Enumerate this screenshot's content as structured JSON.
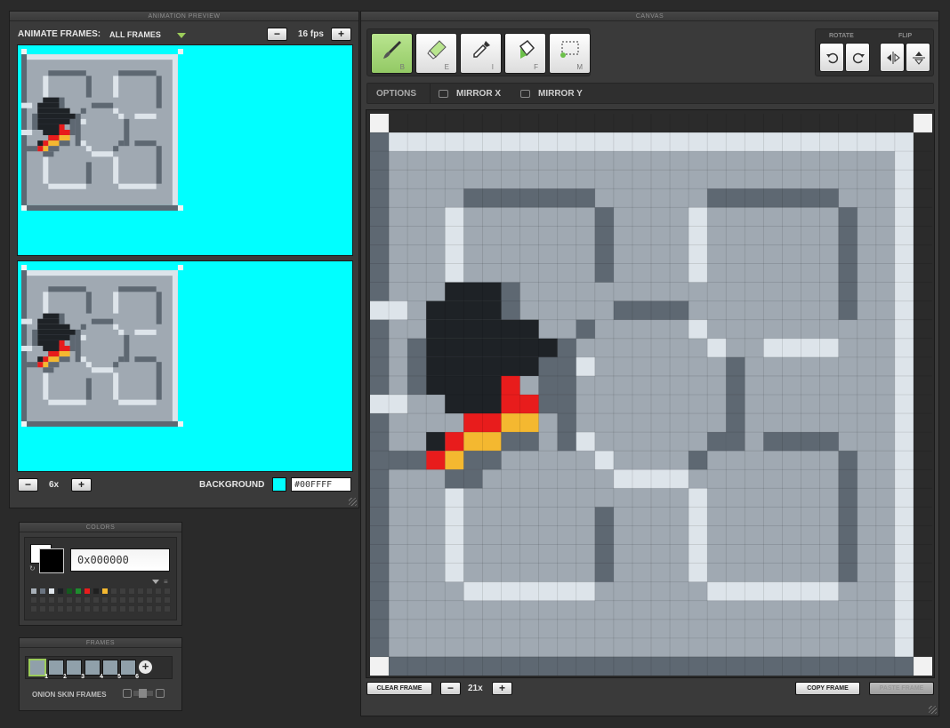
{
  "preview": {
    "panel_title": "ANIMATION PREVIEW",
    "animate_label": "ANIMATE FRAMES:",
    "frames_select": "ALL FRAMES",
    "fps": "16 fps",
    "minus": "−",
    "plus": "+",
    "zoom": "6x",
    "background_label": "BACKGROUND",
    "background_value": "#00FFFF",
    "background_color": "#00ffff"
  },
  "canvas": {
    "panel_title": "CANVAS",
    "tools": [
      {
        "name": "brush",
        "key": "B"
      },
      {
        "name": "eraser",
        "key": "E"
      },
      {
        "name": "eyedropper",
        "key": "I"
      },
      {
        "name": "fill",
        "key": "F"
      },
      {
        "name": "marquee",
        "key": "M"
      }
    ],
    "rotate_label": "ROTATE",
    "flip_label": "FLIP",
    "options_label": "OPTIONS",
    "mirror_x": "MIRROR X",
    "mirror_y": "MIRROR Y",
    "clear_frame": "CLEAR FRAME",
    "zoom": "21x",
    "copy_frame": "COPY FRAME",
    "paste_frame": "PASTE FRAME"
  },
  "colors": {
    "panel_title": "COLORS",
    "primary_hex": "0x000000",
    "swatches": [
      "#a8b0b8",
      "#6a7480",
      "#e0e6ec",
      "#1c2024",
      "#145a1e",
      "#1e8c2e",
      "#e81c1c",
      "#202020",
      "#f4b830"
    ]
  },
  "frames": {
    "panel_title": "FRAMES",
    "numbers": [
      "1",
      "2",
      "3",
      "4",
      "5",
      "6"
    ],
    "add": "+",
    "onion_label": "ONION SKIN FRAMES"
  }
}
